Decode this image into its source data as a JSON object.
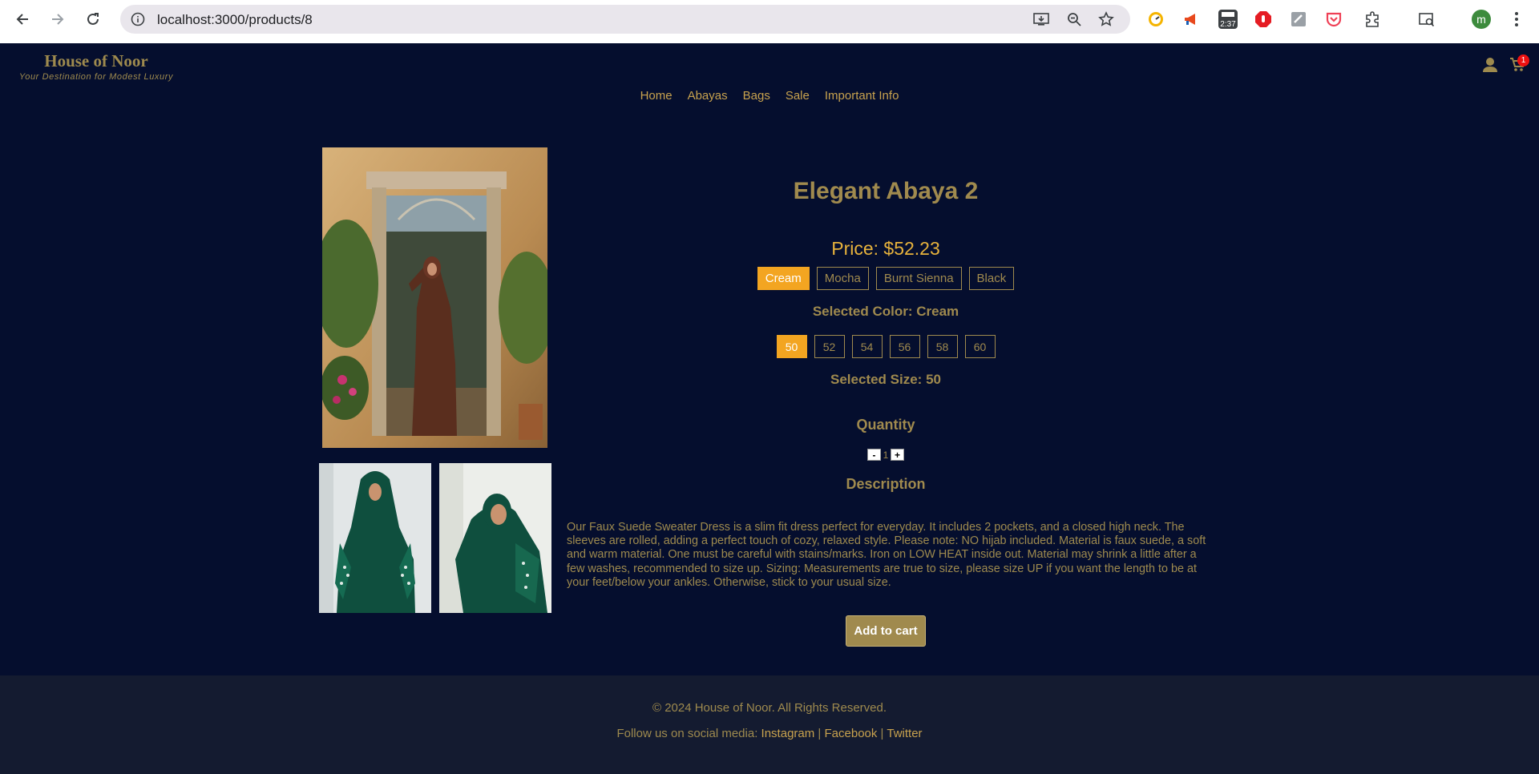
{
  "browser": {
    "url": "localhost:3000/products/8",
    "clock_badge": "2:37",
    "profile_initial": "m"
  },
  "site": {
    "brand_name": "House of Noor",
    "tagline": "Your Destination for Modest Luxury",
    "cart_count": "1",
    "nav": [
      "Home",
      "Abayas",
      "Bags",
      "Sale",
      "Important Info"
    ]
  },
  "product": {
    "title": "Elegant Abaya 2",
    "price": "Price: $52.23",
    "colors": [
      "Cream",
      "Mocha",
      "Burnt Sienna",
      "Black"
    ],
    "selected_color_text": "Selected Color: Cream",
    "sizes": [
      "50",
      "52",
      "54",
      "56",
      "58",
      "60"
    ],
    "selected_size_text": "Selected Size: 50",
    "quantity_label": "Quantity",
    "quantity_minus": "-",
    "quantity_value": "1",
    "quantity_plus": "+",
    "description_label": "Description",
    "description": "Our Faux Suede Sweater Dress is a slim fit dress perfect for everyday. It includes 2 pockets, and a closed high neck. The sleeves are rolled, adding a perfect touch of cozy, relaxed style. Please note: NO hijab included. Material is faux suede, a soft and warm material. One must be careful with stains/marks. Iron on LOW HEAT inside out. Material may shrink a little after a few washes, recommended to size up. Sizing: Measurements are true to size, please size UP if you want the length to be at your feet/below your ankles. Otherwise, stick to your usual size.",
    "add_to_cart": "Add to cart"
  },
  "footer": {
    "copyright": "© 2024 House of Noor. All Rights Reserved.",
    "social_prefix": "Follow us on social media:",
    "links": [
      "Instagram",
      "Facebook",
      "Twitter"
    ],
    "separator": "|"
  },
  "colors": {
    "page_bg": "#050e2e",
    "footer_bg": "#141b30",
    "gold": "#a08a4e",
    "accent": "#f3a521"
  }
}
